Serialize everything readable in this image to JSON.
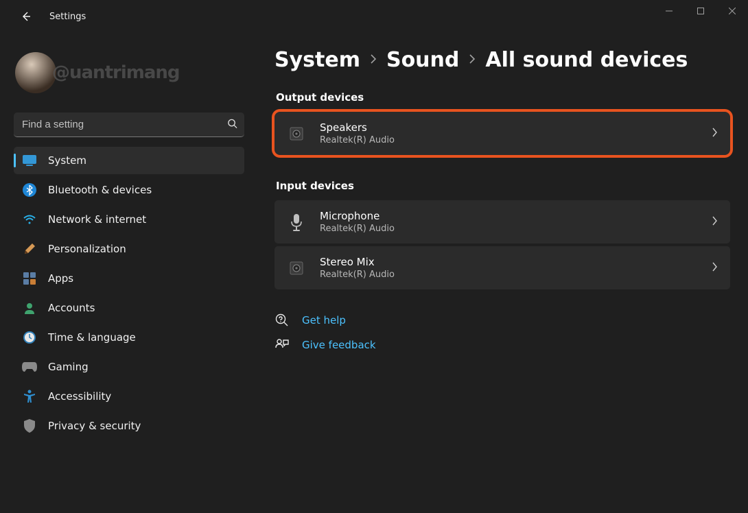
{
  "window": {
    "title": "Settings"
  },
  "profile": {
    "watermark": "@uantrimang"
  },
  "search": {
    "placeholder": "Find a setting"
  },
  "sidebar": {
    "items": [
      {
        "label": "System",
        "icon": "system-icon",
        "active": true
      },
      {
        "label": "Bluetooth & devices",
        "icon": "bluetooth-icon"
      },
      {
        "label": "Network & internet",
        "icon": "wifi-icon"
      },
      {
        "label": "Personalization",
        "icon": "brush-icon"
      },
      {
        "label": "Apps",
        "icon": "apps-icon"
      },
      {
        "label": "Accounts",
        "icon": "account-icon"
      },
      {
        "label": "Time & language",
        "icon": "time-icon"
      },
      {
        "label": "Gaming",
        "icon": "gaming-icon"
      },
      {
        "label": "Accessibility",
        "icon": "accessibility-icon"
      },
      {
        "label": "Privacy & security",
        "icon": "shield-icon"
      }
    ]
  },
  "breadcrumb": {
    "crumbs": [
      {
        "label": "System"
      },
      {
        "label": "Sound"
      },
      {
        "label": "All sound devices"
      }
    ]
  },
  "sections": {
    "output": {
      "heading": "Output devices",
      "items": [
        {
          "title": "Speakers",
          "subtitle": "Realtek(R) Audio",
          "highlight": true
        }
      ]
    },
    "input": {
      "heading": "Input devices",
      "items": [
        {
          "title": "Microphone",
          "subtitle": "Realtek(R) Audio"
        },
        {
          "title": "Stereo Mix",
          "subtitle": "Realtek(R) Audio"
        }
      ]
    }
  },
  "footer": {
    "help": "Get help",
    "feedback": "Give feedback"
  },
  "colors": {
    "accent": "#4cc2ff",
    "highlight": "#e8531f",
    "background": "#1f1f1f",
    "card": "#2b2b2b"
  }
}
